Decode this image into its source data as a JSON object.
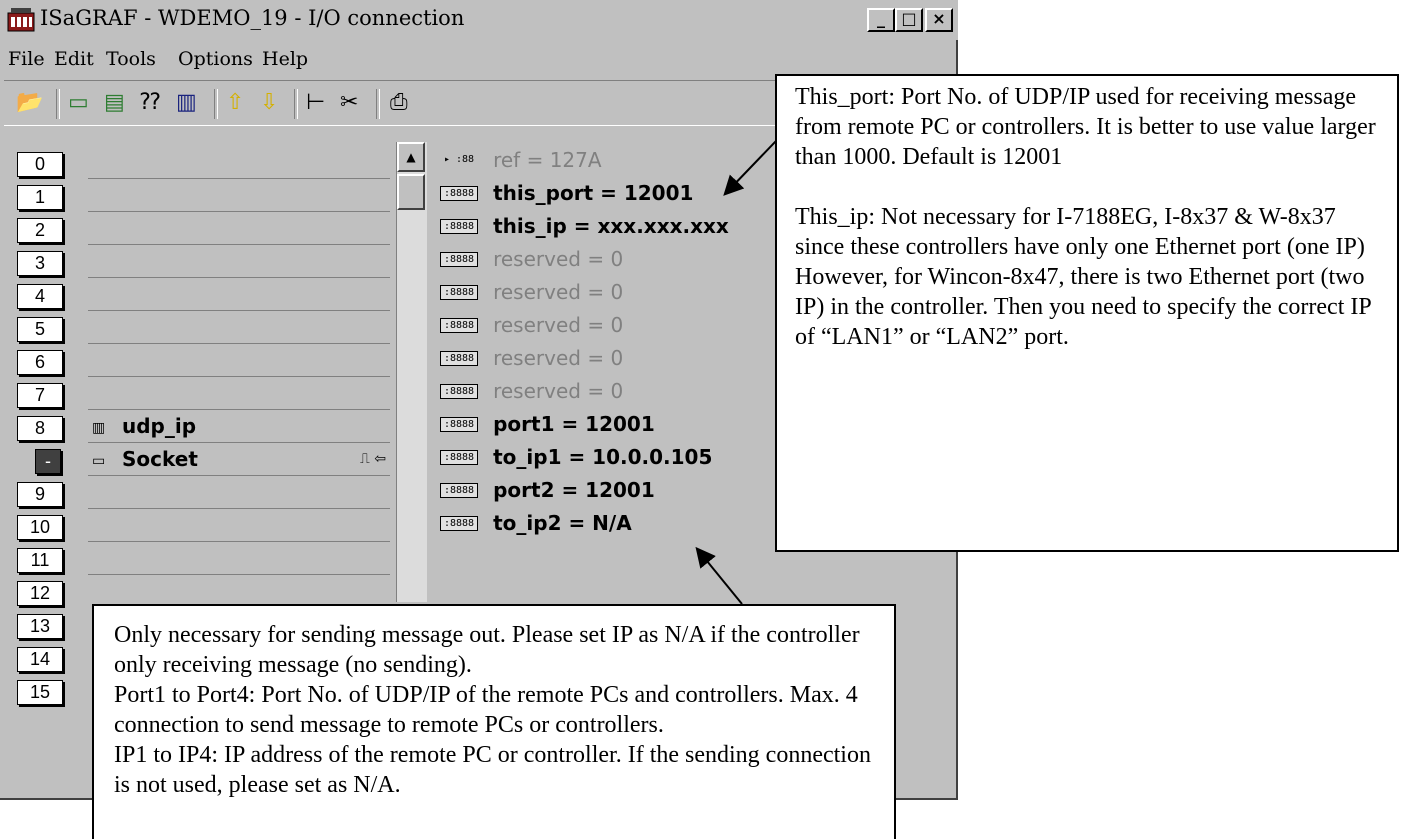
{
  "window": {
    "title": "ISaGRAF - WDEMO_19 - I/O connection",
    "buttons": {
      "minimize": "_",
      "maximize": "□",
      "close": "×"
    }
  },
  "menu": {
    "items": [
      "File",
      "Edit",
      "Tools",
      "Options",
      "Help"
    ]
  },
  "toolbar": {
    "icons": [
      "open-icon",
      "board-icon",
      "boards-icon",
      "question-icon",
      "delete-icon",
      "up-arrow-icon",
      "down-arrow-icon",
      "tree-icon",
      "cut-icon",
      "print-icon"
    ]
  },
  "slots": [
    "0",
    "1",
    "2",
    "3",
    "4",
    "5",
    "6",
    "7",
    "8",
    "-",
    "9",
    "10",
    "11",
    "12",
    "13",
    "14",
    "15"
  ],
  "boards": {
    "udp_ip": "udp_ip",
    "socket": "Socket",
    "socket_extra": "⎍ ⇦"
  },
  "vars": [
    {
      "icon": "▸ :88",
      "text": "ref = 127A",
      "active": false
    },
    {
      "icon": ":8888",
      "text": "this_port = 12001",
      "active": true
    },
    {
      "icon": ":8888",
      "text": "this_ip = xxx.xxx.xxx",
      "active": true
    },
    {
      "icon": ":8888",
      "text": "reserved = 0",
      "active": false
    },
    {
      "icon": ":8888",
      "text": "reserved = 0",
      "active": false
    },
    {
      "icon": ":8888",
      "text": "reserved = 0",
      "active": false
    },
    {
      "icon": ":8888",
      "text": "reserved = 0",
      "active": false
    },
    {
      "icon": ":8888",
      "text": "reserved = 0",
      "active": false
    },
    {
      "icon": ":8888",
      "text": "port1 = 12001",
      "active": true
    },
    {
      "icon": ":8888",
      "text": "to_ip1 = 10.0.0.105",
      "active": true
    },
    {
      "icon": ":8888",
      "text": "port2 = 12001",
      "active": true
    },
    {
      "icon": ":8888",
      "text": "to_ip2 = N/A",
      "active": true
    }
  ],
  "callout_top": {
    "p1": "This_port: Port No. of UDP/IP used for receiving message from remote PC or controllers. It is better to use value larger than 1000. Default is 12001",
    "p2": "This_ip: Not necessary for I-7188EG, I-8x37 & W-8x37 since these controllers have only one Ethernet port (one IP)",
    "p3": "However, for Wincon-8x47, there is two Ethernet port (two IP) in the controller. Then you need to specify the correct IP of “LAN1” or “LAN2” port."
  },
  "callout_bottom": {
    "p1": "Only necessary for sending message out. Please set IP as N/A if the controller only receiving message (no sending).",
    "p2": "Port1 to Port4:  Port No. of UDP/IP of the remote PCs and controllers. Max. 4 connection to send message to remote PCs or controllers.",
    "p3": "IP1 to IP4: IP address of the remote PC or controller. If the sending connection is not used, please set as N/A."
  }
}
